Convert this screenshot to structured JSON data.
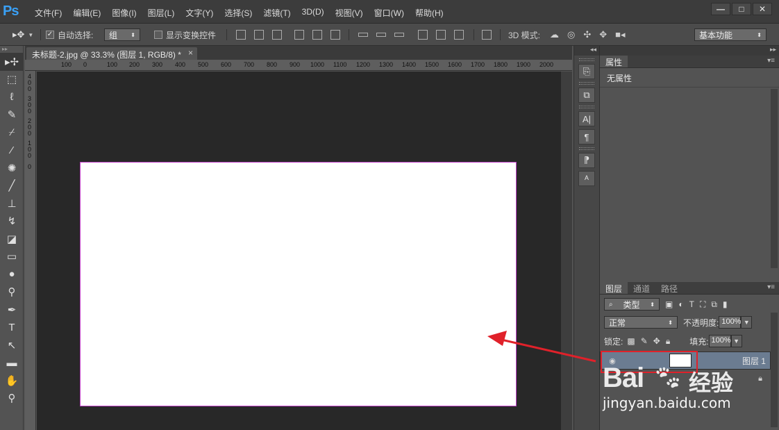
{
  "app": {
    "logo": "Ps"
  },
  "menu": [
    "文件(F)",
    "编辑(E)",
    "图像(I)",
    "图层(L)",
    "文字(Y)",
    "选择(S)",
    "滤镜(T)",
    "3D(D)",
    "视图(V)",
    "窗口(W)",
    "帮助(H)"
  ],
  "window_controls": {
    "minimize": "—",
    "maximize": "□",
    "close": "✕"
  },
  "options": {
    "auto_select_label": "自动选择:",
    "auto_select_value": "组",
    "show_transform_label": "显示变换控件",
    "mode3d_label": "3D 模式:",
    "workspace": "基本功能"
  },
  "document": {
    "tab_title": "未标题-2.jpg @ 33.3% (图层 1, RGB/8) *",
    "tab_close": "×",
    "ruler_h": [
      "100",
      "0",
      "100",
      "200",
      "300",
      "400",
      "500",
      "600",
      "700",
      "800",
      "900",
      "1000",
      "1100",
      "1200",
      "1300",
      "1400",
      "1500",
      "1600",
      "1700",
      "1800",
      "1900",
      "2000"
    ],
    "ruler_v": [
      "400",
      "300",
      "200",
      "100",
      "0"
    ]
  },
  "properties": {
    "tab": "属性",
    "content": "无属性"
  },
  "layers_panel": {
    "tabs": [
      "图层",
      "通道",
      "路径"
    ],
    "filter": "类型",
    "blend_mode": "正常",
    "opacity_label": "不透明度:",
    "opacity_value": "100%",
    "lock_label": "锁定:",
    "fill_label": "填充:",
    "fill_value": "100%",
    "layers": [
      {
        "name": "图层 1"
      }
    ]
  },
  "watermark": {
    "logo": "Bai",
    "logo_cn": "经验",
    "url": "jingyan.baidu.com"
  },
  "colors": {
    "selection_red": "#e0212a",
    "canvas_border": "#c03ec8",
    "ps_blue": "#3aa0f5"
  }
}
